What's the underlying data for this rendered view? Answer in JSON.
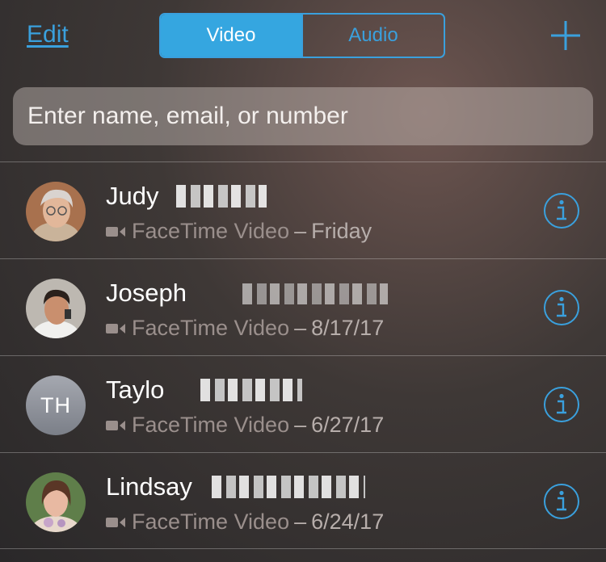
{
  "colors": {
    "accent": "#3aa0dd",
    "segment_active_bg": "#35a6e0"
  },
  "header": {
    "edit_label": "Edit",
    "tabs": [
      {
        "label": "Video",
        "active": true
      },
      {
        "label": "Audio",
        "active": false
      }
    ],
    "add_icon": "plus-icon"
  },
  "search": {
    "placeholder": "Enter name, email, or number",
    "value": ""
  },
  "contacts": [
    {
      "name": "Judy",
      "call_type": "FaceTime Video",
      "separator": "–",
      "date": "Friday",
      "avatar": "photo",
      "info_icon": "info-icon",
      "video_icon": "video-camera-icon"
    },
    {
      "name": "Joseph",
      "call_type": "FaceTime Video",
      "separator": "–",
      "date": "8/17/17",
      "avatar": "photo",
      "info_icon": "info-icon",
      "video_icon": "video-camera-icon"
    },
    {
      "name": "Taylo",
      "call_type": "FaceTime Video",
      "separator": "–",
      "date": "6/27/17",
      "avatar": "initials",
      "initials": "TH",
      "info_icon": "info-icon",
      "video_icon": "video-camera-icon"
    },
    {
      "name": "Lindsay",
      "call_type": "FaceTime Video",
      "separator": "–",
      "date": "6/24/17",
      "avatar": "photo",
      "info_icon": "info-icon",
      "video_icon": "video-camera-icon"
    }
  ]
}
